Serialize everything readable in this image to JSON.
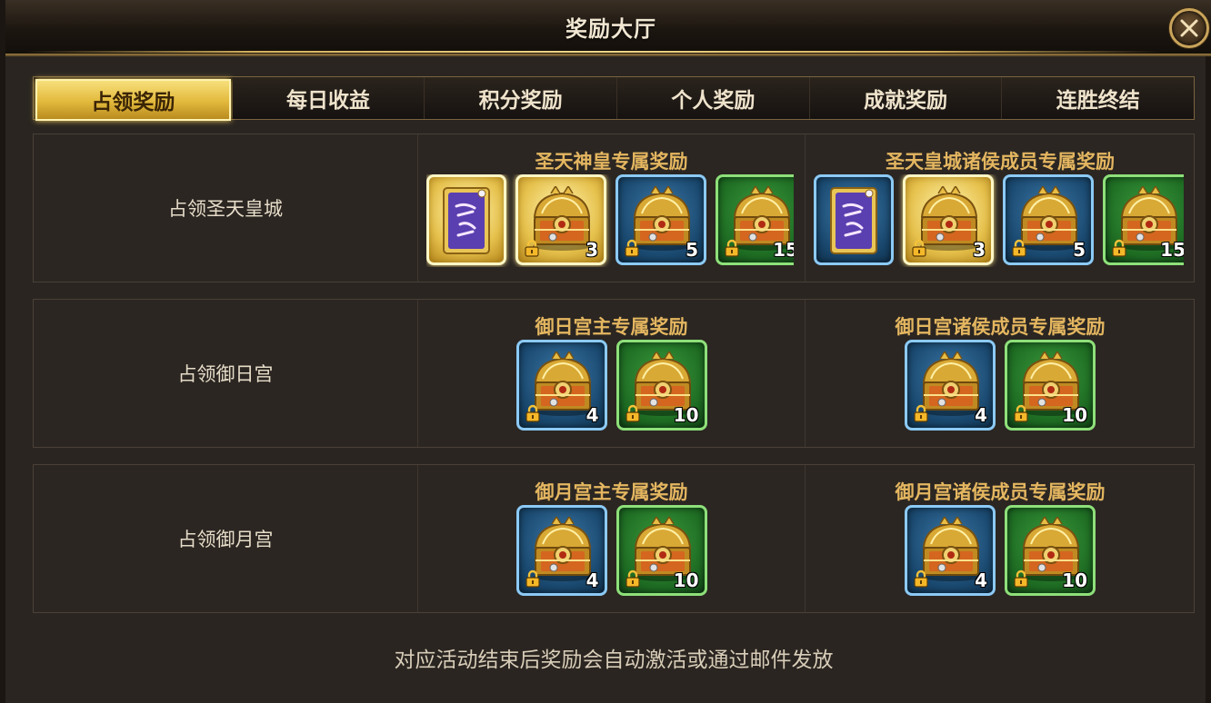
{
  "window": {
    "title": "奖励大厅"
  },
  "tabs": [
    "占领奖励",
    "每日收益",
    "积分奖励",
    "个人奖励",
    "成就奖励",
    "连胜终结"
  ],
  "active_tab": 0,
  "rows": [
    {
      "label": "占领圣天皇城",
      "groups": [
        {
          "title": "圣天神皇专属奖励",
          "items": [
            {
              "type": "scroll",
              "frame": "gold",
              "count": ""
            },
            {
              "type": "chest",
              "frame": "gold",
              "locked": true,
              "count": "3"
            },
            {
              "type": "chest",
              "frame": "blue",
              "locked": true,
              "count": "5"
            },
            {
              "type": "chest",
              "frame": "green",
              "locked": true,
              "count": "15"
            }
          ]
        },
        {
          "title": "圣天皇城诸侯成员专属奖励",
          "items": [
            {
              "type": "scroll",
              "frame": "blue",
              "count": ""
            },
            {
              "type": "chest",
              "frame": "gold",
              "locked": true,
              "count": "3"
            },
            {
              "type": "chest",
              "frame": "blue",
              "locked": true,
              "count": "5"
            },
            {
              "type": "chest",
              "frame": "green",
              "locked": true,
              "count": "15"
            }
          ]
        }
      ]
    },
    {
      "label": "占领御日宫",
      "groups": [
        {
          "title": "御日宫主专属奖励",
          "items": [
            {
              "type": "chest",
              "frame": "blue",
              "locked": true,
              "count": "4"
            },
            {
              "type": "chest",
              "frame": "green",
              "locked": true,
              "count": "10"
            }
          ]
        },
        {
          "title": "御日宫诸侯成员专属奖励",
          "items": [
            {
              "type": "chest",
              "frame": "blue",
              "locked": true,
              "count": "4"
            },
            {
              "type": "chest",
              "frame": "green",
              "locked": true,
              "count": "10"
            }
          ]
        }
      ]
    },
    {
      "label": "占领御月宫",
      "groups": [
        {
          "title": "御月宫主专属奖励",
          "items": [
            {
              "type": "chest",
              "frame": "blue",
              "locked": true,
              "count": "4"
            },
            {
              "type": "chest",
              "frame": "green",
              "locked": true,
              "count": "10"
            }
          ]
        },
        {
          "title": "御月宫诸侯成员专属奖励",
          "items": [
            {
              "type": "chest",
              "frame": "blue",
              "locked": true,
              "count": "4"
            },
            {
              "type": "chest",
              "frame": "green",
              "locked": true,
              "count": "10"
            }
          ]
        }
      ]
    }
  ],
  "footer_note": "对应活动结束后奖励会自动激活或通过邮件发放",
  "colors": {
    "accent_gold": "#e4b660",
    "frame_blue": "#8ccaf6",
    "frame_green": "#8ee07a",
    "frame_gold": "#fff7c6"
  },
  "icons": {
    "close": "close-icon",
    "chest": "treasure-chest-icon",
    "scroll": "scroll-icon",
    "lock": "lock-icon"
  }
}
